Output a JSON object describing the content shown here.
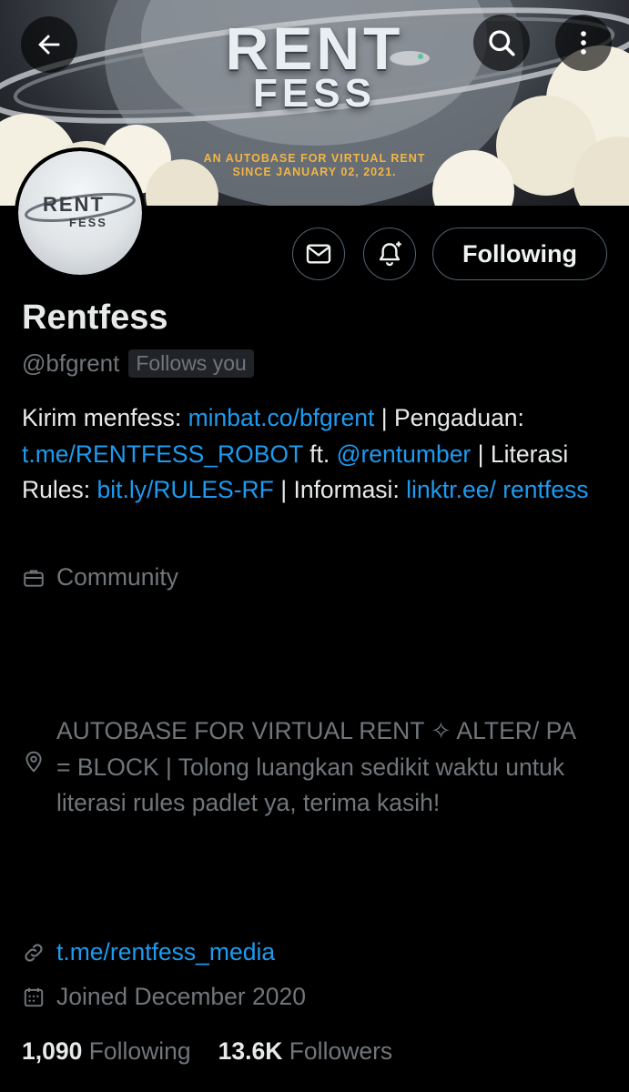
{
  "banner": {
    "title_line1": "RENT",
    "title_line2": "FESS",
    "tagline_line1": "AN AUTOBASE FOR VIRTUAL RENT",
    "tagline_line2": "SINCE JANUARY 02, 2021."
  },
  "header": {
    "back_icon": "arrow-left-icon",
    "search_icon": "search-icon",
    "more_icon": "more-vertical-icon"
  },
  "avatar": {
    "text_line1": "RENT",
    "text_line2": "FESS"
  },
  "actions": {
    "message_icon": "envelope-icon",
    "notify_icon": "bell-plus-icon",
    "following_label": "Following"
  },
  "profile": {
    "display_name": "Rentfess",
    "handle": "@bfgrent",
    "follows_you": "Follows you"
  },
  "bio": {
    "t1": "Kirim menfess: ",
    "l1": "minbat.co/bfgrent",
    "t2": " | Pengaduan: ",
    "l2": "t.me/RENTFESS_ROBOT",
    "t3": " ft. ",
    "l3": "@rentumber",
    "t4": " | Literasi Rules: ",
    "l4": "bit.ly/RULES-RF",
    "t5": " | Informasi: ",
    "l5": "linktr.ee/ rentfess"
  },
  "meta": {
    "category": "Community",
    "location": "AUTOBASE FOR VIRTUAL RENT ✧ ALTER/ PA = BLOCK | Tolong luangkan sedikit waktu untuk literasi rules padlet ya, terima kasih!",
    "website": "t.me/rentfess_media",
    "joined": "Joined December 2020"
  },
  "stats": {
    "following_count": "1,090",
    "following_label": "Following",
    "followers_count": "13.6K",
    "followers_label": "Followers"
  },
  "colors": {
    "background": "#000000",
    "text_primary": "#e7e9ea",
    "text_secondary": "#71767b",
    "link": "#1d9bf0",
    "border": "#536471",
    "banner_accent": "#f2b544"
  }
}
